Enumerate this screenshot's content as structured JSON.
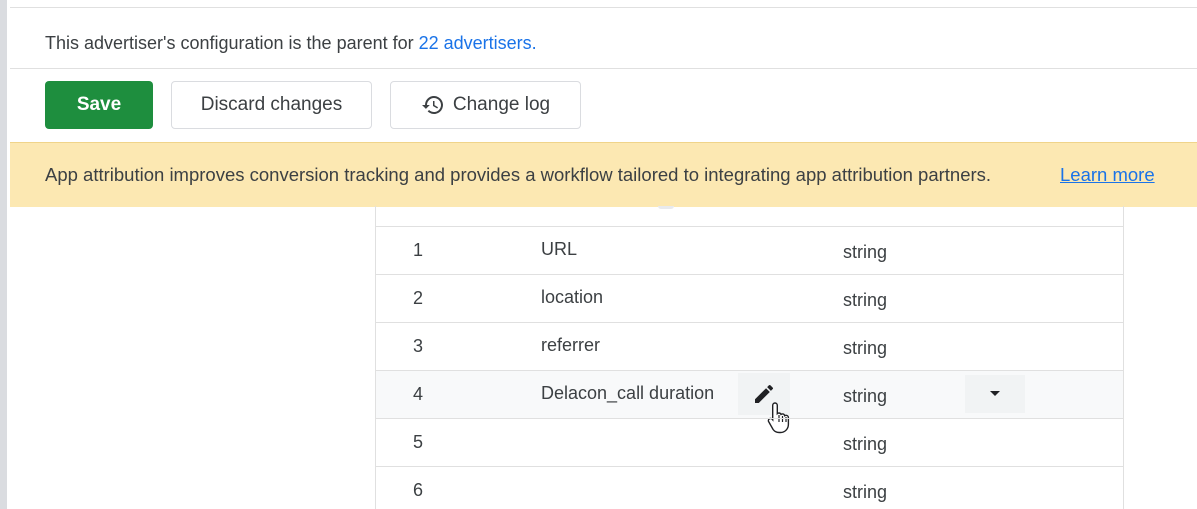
{
  "parent_note": {
    "prefix": "This advertiser's configuration is the parent for ",
    "link_text": "22 advertisers."
  },
  "toolbar": {
    "save_label": "Save",
    "discard_label": "Discard changes",
    "changelog_label": "Change log",
    "changelog_icon": "history-icon"
  },
  "banner": {
    "text": "App attribution improves conversion tracking and provides a workflow tailored to integrating app attribution partners.",
    "link_text": "Learn more"
  },
  "table": {
    "rows": [
      {
        "num": "1",
        "name": "URL",
        "type": "string"
      },
      {
        "num": "2",
        "name": "location",
        "type": "string"
      },
      {
        "num": "3",
        "name": "referrer",
        "type": "string"
      },
      {
        "num": "4",
        "name": "Delacon_call duration",
        "type": "string",
        "hovered": true
      },
      {
        "num": "5",
        "name": "",
        "type": "string"
      },
      {
        "num": "6",
        "name": "",
        "type": "string"
      }
    ]
  },
  "colors": {
    "save": "#1e8e3e",
    "banner": "#fce8b2",
    "link": "#1a73e8"
  }
}
